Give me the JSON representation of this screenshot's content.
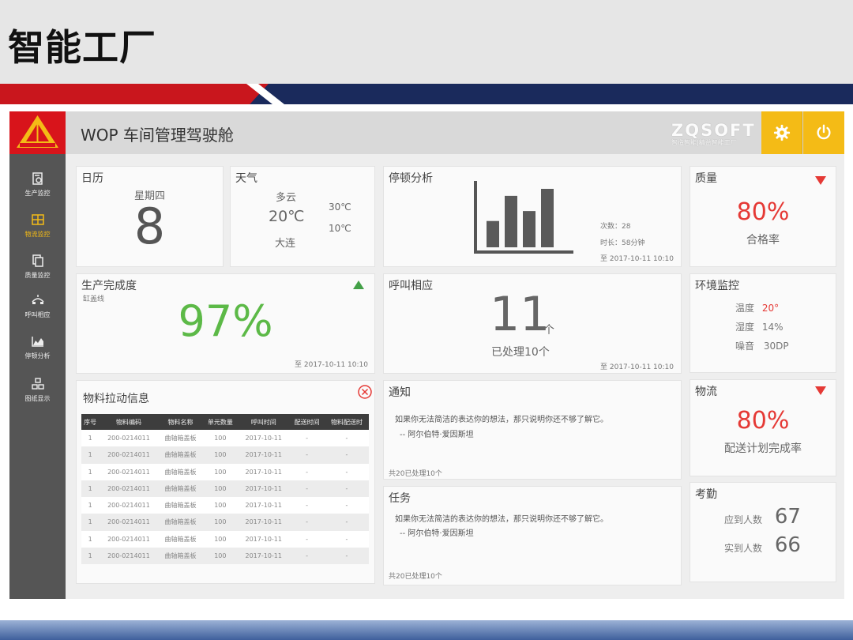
{
  "slide": {
    "title": "智能工厂"
  },
  "header": {
    "title": "WOP 车间管理驾驶舱",
    "brand": "ZQSOFT",
    "brand_sub": "智造智能|精益智能工厂"
  },
  "sidebar": {
    "items": [
      {
        "label": "生产监控",
        "icon": "production-monitor-icon"
      },
      {
        "label": "物流监控",
        "icon": "logistics-monitor-icon",
        "active": true
      },
      {
        "label": "质量监控",
        "icon": "quality-monitor-icon"
      },
      {
        "label": "呼叫相应",
        "icon": "call-response-icon"
      },
      {
        "label": "停顿分析",
        "icon": "downtime-analysis-icon"
      },
      {
        "label": "图纸显示",
        "icon": "drawing-display-icon"
      }
    ]
  },
  "calendar": {
    "title": "日历",
    "weekday": "星期四",
    "day": "8"
  },
  "weather": {
    "title": "天气",
    "condition": "多云",
    "temp": "20℃",
    "high": "30℃",
    "low": "10℃",
    "city": "大连"
  },
  "downtime": {
    "title": "停顿分析",
    "count": "次数：28",
    "duration": "时长：58分钟",
    "date": "至 2017-10-11 10:10",
    "bars": [
      0.45,
      0.88,
      0.62,
      1.0
    ]
  },
  "quality": {
    "title": "质量",
    "value": "80%",
    "label": "合格率",
    "accent": "#e53935"
  },
  "production": {
    "title": "生产完成度",
    "line": "缸盖线",
    "value": "97%",
    "date": "至 2017-10-11 10:10",
    "accent": "#5cb947"
  },
  "call": {
    "title": "呼叫相应",
    "count": "11",
    "unit": "个",
    "handled": "已处理10个",
    "date": "至 2017-10-11 10:10"
  },
  "environment": {
    "title": "环境监控",
    "rows": [
      {
        "label": "温度",
        "value": "20°",
        "alert": true
      },
      {
        "label": "湿度",
        "value": "14%"
      },
      {
        "label": "噪音",
        "value": "30DP"
      }
    ]
  },
  "material": {
    "title": "物料拉动信息",
    "columns": [
      "序号",
      "物料编码",
      "物料名称",
      "单元数量",
      "呼叫时间",
      "配送时间",
      "物料配送时"
    ],
    "rows": [
      [
        "1",
        "200-0214011",
        "曲轴箱盖板",
        "100",
        "2017-10-11",
        "-",
        "-"
      ],
      [
        "1",
        "200-0214011",
        "曲轴箱盖板",
        "100",
        "2017-10-11",
        "-",
        "-"
      ],
      [
        "1",
        "200-0214011",
        "曲轴箱盖板",
        "100",
        "2017-10-11",
        "-",
        "-"
      ],
      [
        "1",
        "200-0214011",
        "曲轴箱盖板",
        "100",
        "2017-10-11",
        "-",
        "-"
      ],
      [
        "1",
        "200-0214011",
        "曲轴箱盖板",
        "100",
        "2017-10-11",
        "-",
        "-"
      ],
      [
        "1",
        "200-0214011",
        "曲轴箱盖板",
        "100",
        "2017-10-11",
        "-",
        "-"
      ],
      [
        "1",
        "200-0214011",
        "曲轴箱盖板",
        "100",
        "2017-10-11",
        "-",
        "-"
      ],
      [
        "1",
        "200-0214011",
        "曲轴箱盖板",
        "100",
        "2017-10-11",
        "-",
        "-"
      ]
    ]
  },
  "notice": {
    "title": "通知",
    "quote": "如果你无法简洁的表达你的想法，那只说明你还不够了解它。",
    "author": "-- 阿尔伯特·爱因斯坦",
    "footer": "共20已处理10个"
  },
  "task": {
    "title": "任务",
    "quote": "如果你无法简洁的表达你的想法，那只说明你还不够了解它。",
    "author": "-- 阿尔伯特·爱因斯坦",
    "footer": "共20已处理10个"
  },
  "logistics": {
    "title": "物流",
    "value": "80%",
    "label": "配送计划完成率"
  },
  "attendance": {
    "title": "考勤",
    "rows": [
      {
        "label": "应到人数",
        "value": "67"
      },
      {
        "label": "实到人数",
        "value": "66"
      }
    ]
  }
}
